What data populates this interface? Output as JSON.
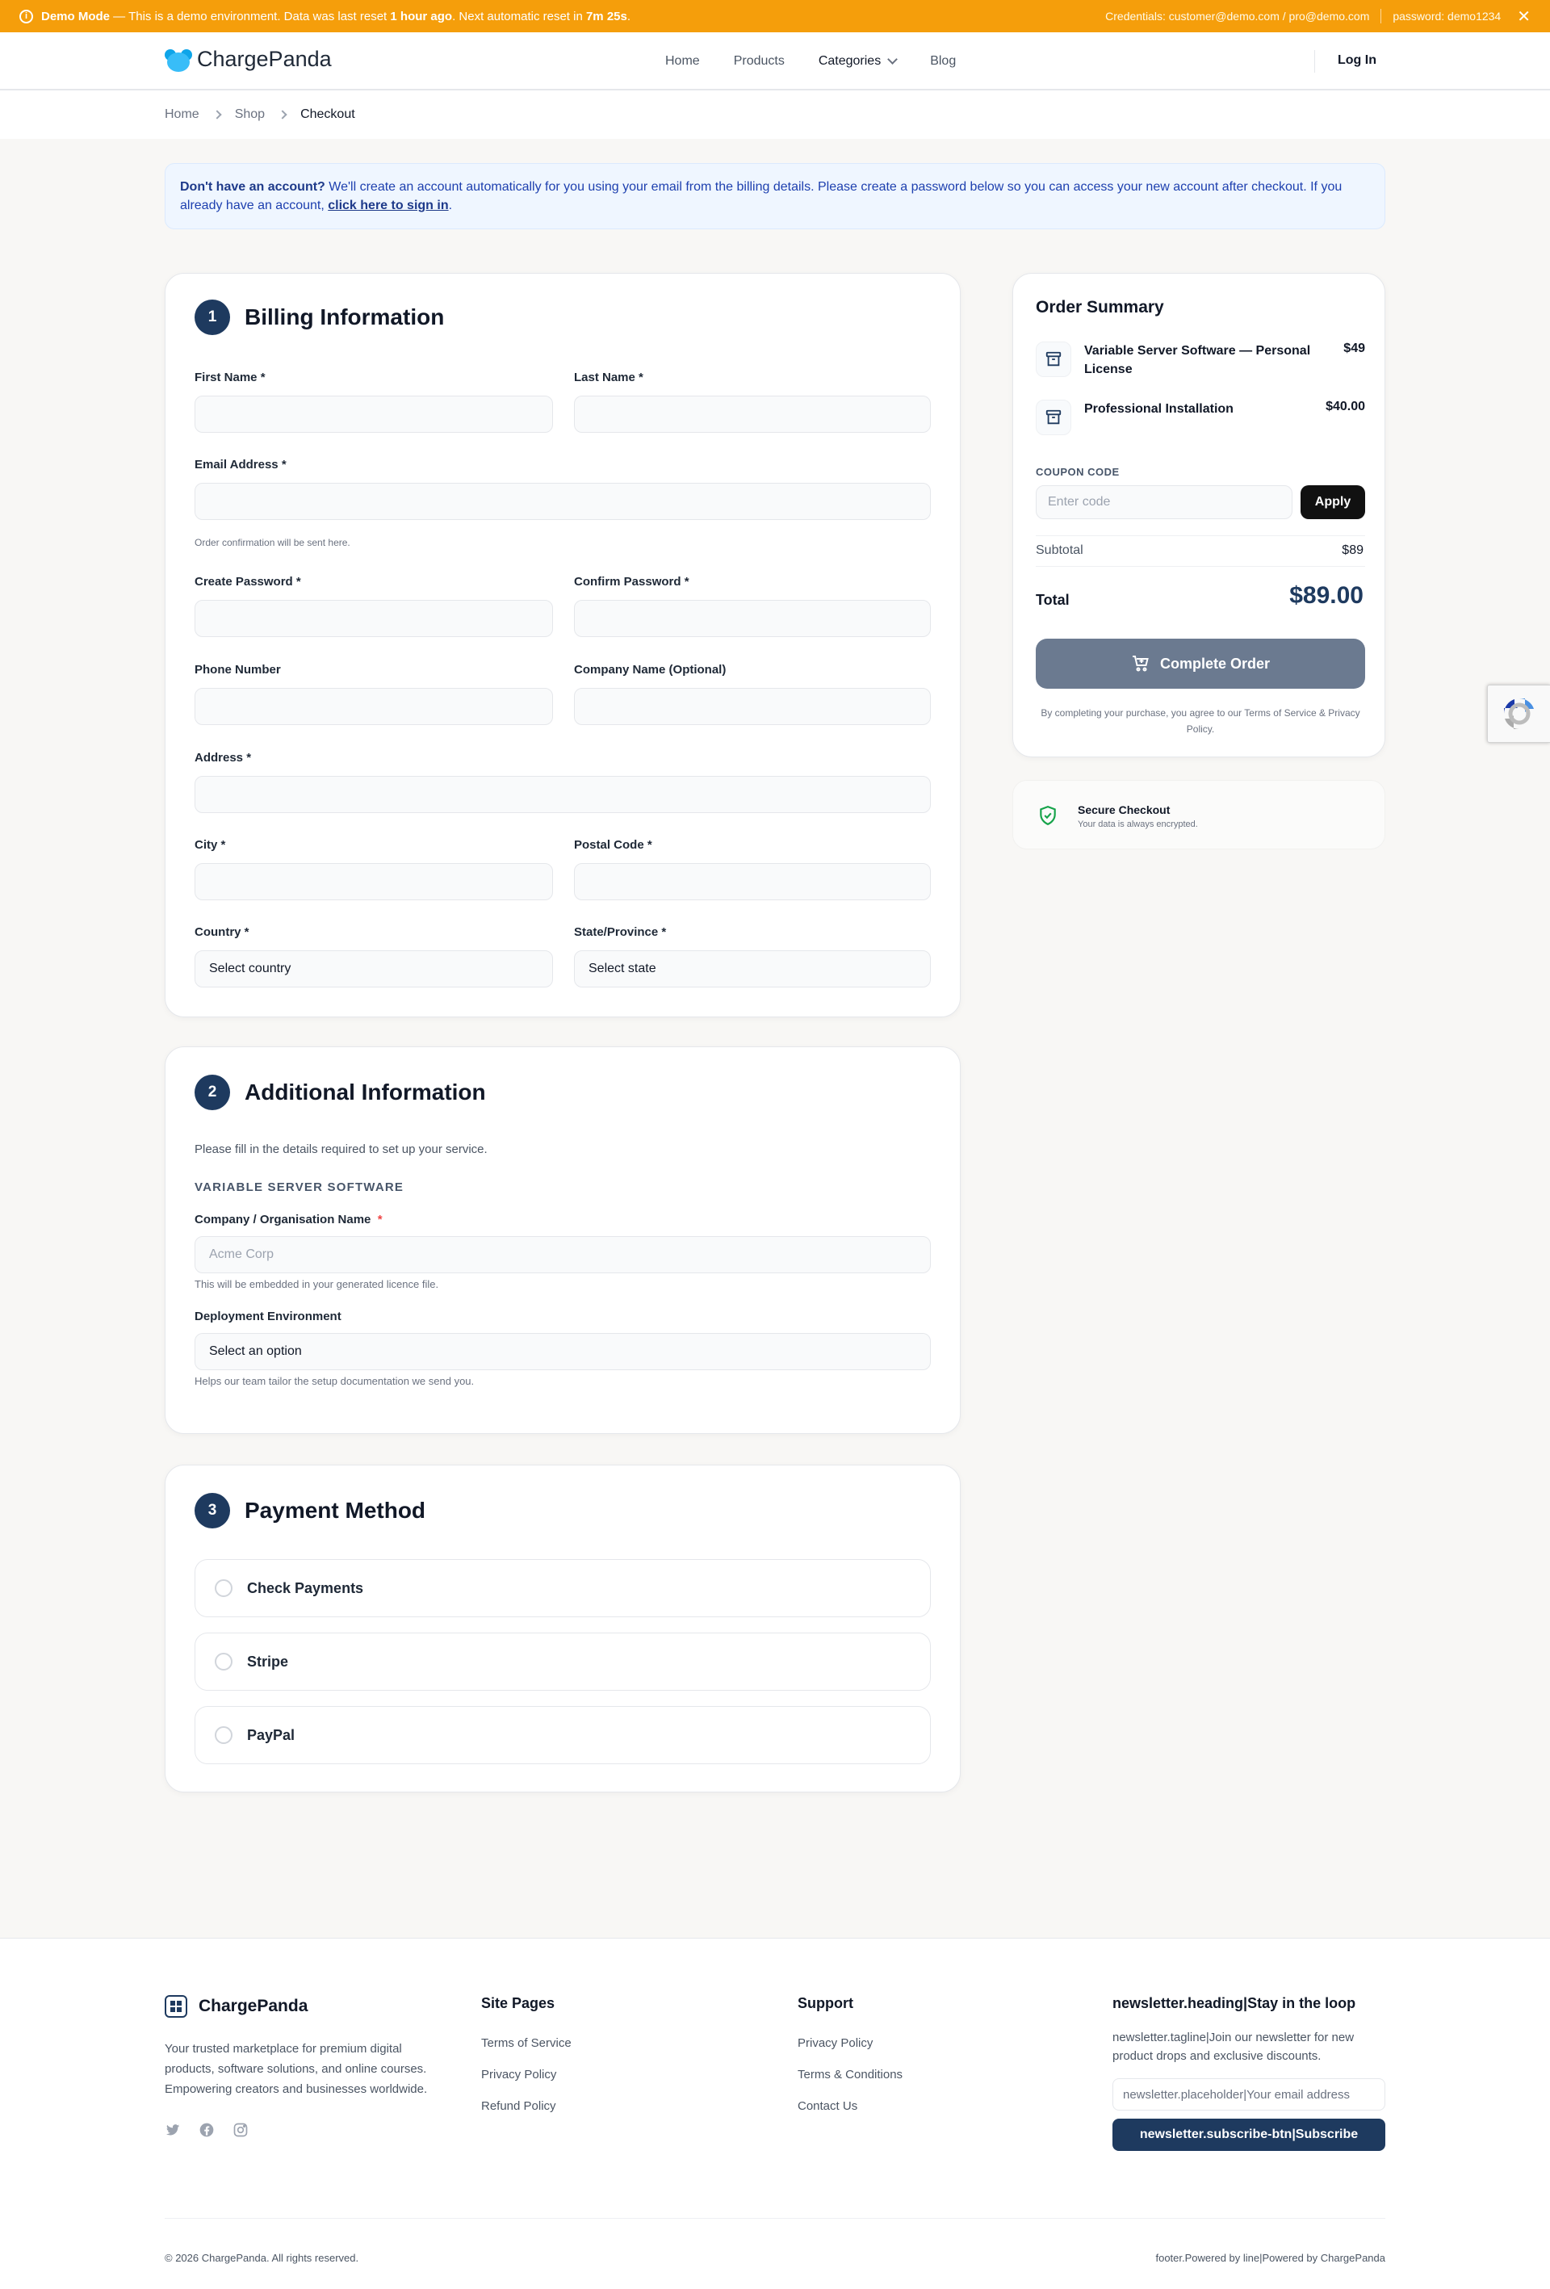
{
  "demo": {
    "label": "Demo Mode",
    "text_pre": " — This is a demo environment. Data was last reset ",
    "last_reset": "1 hour ago",
    "text_mid": ". Next automatic reset in ",
    "next_reset": "7m 25s",
    "text_end": ".",
    "credentials": "Credentials: customer@demo.com / pro@demo.com",
    "password": "password: demo1234"
  },
  "header": {
    "brand": "ChargePanda",
    "nav": [
      "Home",
      "Products",
      "Categories",
      "Blog"
    ],
    "login": "Log In"
  },
  "breadcrumb": [
    "Home",
    "Shop",
    "Checkout"
  ],
  "notice": {
    "strong": "Don't have an account?",
    "text": " We'll create an account automatically for you using your email from the billing details. Please create a password below so you can access your new account after checkout. If you already have an account, ",
    "link": "click here to sign in",
    "end": "."
  },
  "billing": {
    "step": "1",
    "title": "Billing Information",
    "first_name": "First Name *",
    "last_name": "Last Name *",
    "email": "Email Address *",
    "email_hint": "Order confirmation will be sent here.",
    "password": "Create Password *",
    "confirm_password": "Confirm Password *",
    "phone": "Phone Number",
    "company": "Company Name (Optional)",
    "address": "Address *",
    "city": "City *",
    "postal": "Postal Code *",
    "country": "Country *",
    "country_value": "Select country",
    "state": "State/Province *",
    "state_value": "Select state"
  },
  "additional": {
    "step": "2",
    "title": "Additional Information",
    "intro": "Please fill in the details required to set up your service.",
    "group": "VARIABLE SERVER SOFTWARE",
    "org_label": "Company / Organisation Name",
    "org_req": "*",
    "org_placeholder": "Acme Corp",
    "org_hint": "This will be embedded in your generated licence file.",
    "env_label": "Deployment Environment",
    "env_value": "Select an option",
    "env_hint": "Helps our team tailor the setup documentation we send you."
  },
  "payment": {
    "step": "3",
    "title": "Payment Method",
    "options": [
      "Check Payments",
      "Stripe",
      "PayPal"
    ]
  },
  "summary": {
    "title": "Order Summary",
    "items": [
      {
        "name": "Variable Server Software — Personal License",
        "price": "$49"
      },
      {
        "name": "Professional Installation",
        "price": "$40.00"
      }
    ],
    "coupon_label": "COUPON CODE",
    "coupon_placeholder": "Enter code",
    "apply": "Apply",
    "subtotal_label": "Subtotal",
    "subtotal": "$89",
    "total_label": "Total",
    "total": "$89.00",
    "complete": "Complete Order",
    "terms": "By completing your purchase, you agree to our Terms of Service & Privacy Policy."
  },
  "secure": {
    "title": "Secure Checkout",
    "text": "Your data is always encrypted."
  },
  "footer": {
    "brand": "ChargePanda",
    "description": "Your trusted marketplace for premium digital products, software solutions, and online courses. Empowering creators and businesses worldwide.",
    "site_pages_title": "Site Pages",
    "site_pages": [
      "Terms of Service",
      "Privacy Policy",
      "Refund Policy"
    ],
    "support_title": "Support",
    "support": [
      "Privacy Policy",
      "Terms & Conditions",
      "Contact Us"
    ],
    "newsletter_heading": "newsletter.heading|Stay in the loop",
    "newsletter_tagline": "newsletter.tagline|Join our newsletter for new product drops and exclusive discounts.",
    "newsletter_placeholder": "newsletter.placeholder|Your email address",
    "newsletter_button": "newsletter.subscribe-btn|Subscribe",
    "copyright": "© 2026 ChargePanda. All rights reserved.",
    "powered": "footer.Powered by line|Powered by ChargePanda"
  },
  "colors": {
    "demo_bar": "#f59e0b",
    "step_badge": "#1e3a5f",
    "complete_button": "#6b7a90",
    "total": "#1e3a5f"
  }
}
